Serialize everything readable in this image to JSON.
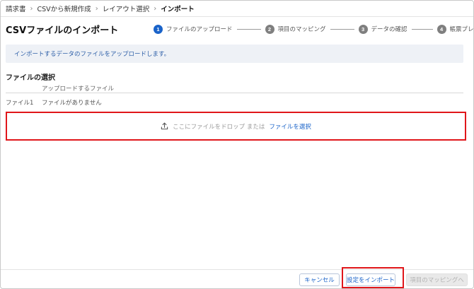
{
  "breadcrumb": {
    "items": [
      "請求書",
      "CSVから新規作成",
      "レイアウト選択",
      "インポート"
    ],
    "separator": "›"
  },
  "page": {
    "title": "CSVファイルのインポート"
  },
  "stepper": {
    "steps": [
      {
        "num": "1",
        "label": "ファイルのアップロード",
        "active": true
      },
      {
        "num": "2",
        "label": "項目のマッピング",
        "active": false
      },
      {
        "num": "3",
        "label": "データの確認",
        "active": false
      },
      {
        "num": "4",
        "label": "帳票プレビュー",
        "active": false
      }
    ]
  },
  "info": {
    "message": "インポートするデータのファイルをアップロードします。"
  },
  "file_section": {
    "title": "ファイルの選択",
    "column_header": "アップロードするファイル",
    "row_label": "ファイル1",
    "row_value": "ファイルがありません"
  },
  "drop_zone": {
    "icon": "upload-icon",
    "text": "ここにファイルをドロップ または",
    "link": "ファイルを選択"
  },
  "footer": {
    "cancel_label": "キャンセル",
    "import_settings_label": "設定をインポート",
    "next_label": "項目のマッピングへ"
  },
  "colors": {
    "accent": "#1a63c9",
    "highlight": "#e0161a",
    "info_bg": "#eef1f6"
  }
}
